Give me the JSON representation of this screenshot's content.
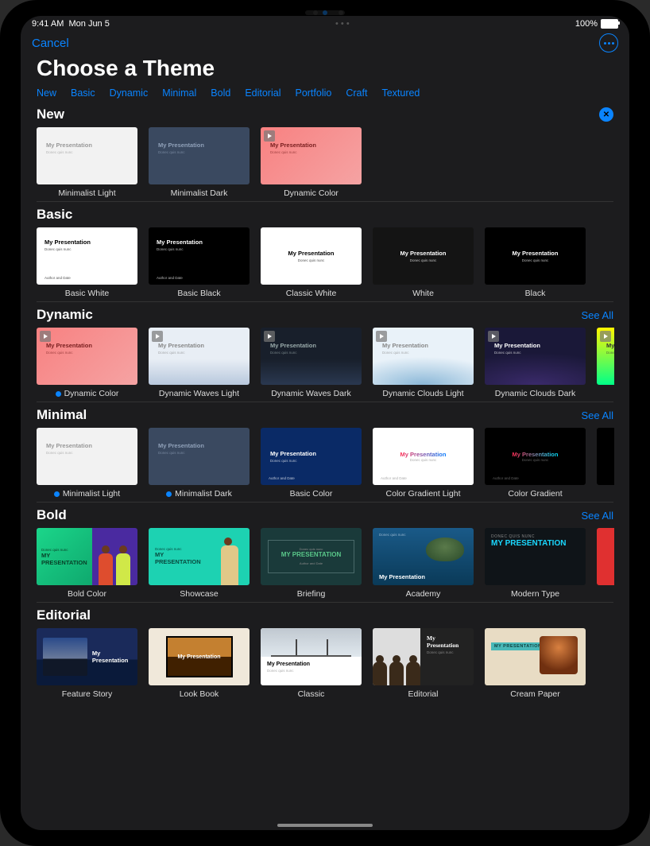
{
  "status": {
    "time": "9:41 AM",
    "date": "Mon Jun 5",
    "battery": "100%"
  },
  "nav": {
    "cancel": "Cancel"
  },
  "title": "Choose a Theme",
  "categories": [
    "New",
    "Basic",
    "Dynamic",
    "Minimal",
    "Bold",
    "Editorial",
    "Portfolio",
    "Craft",
    "Textured"
  ],
  "see_all": "See All",
  "preview": {
    "heading": "My Presentation",
    "sub": "Donec quis nunc",
    "sub2": "Author and Date",
    "upper": "MY PRESENTATION",
    "donec_upper": "DONEC QUIS NUNC"
  },
  "sections": {
    "new": {
      "title": "New",
      "items": [
        {
          "label": "Minimalist Light",
          "style": "th-min-light",
          "play": false
        },
        {
          "label": "Minimalist Dark",
          "style": "th-min-dark",
          "play": false
        },
        {
          "label": "Dynamic Color",
          "style": "th-dyn-color",
          "play": true
        }
      ]
    },
    "basic": {
      "title": "Basic",
      "items": [
        {
          "label": "Basic White",
          "style": "th-basic-white"
        },
        {
          "label": "Basic Black",
          "style": "th-basic-black"
        },
        {
          "label": "Classic White",
          "style": "th-classic-white"
        },
        {
          "label": "White",
          "style": "th-white"
        },
        {
          "label": "Black",
          "style": "th-black"
        }
      ]
    },
    "dynamic": {
      "title": "Dynamic",
      "see_all": true,
      "items": [
        {
          "label": "Dynamic Color",
          "style": "th-dyn-color",
          "play": true,
          "dot": true
        },
        {
          "label": "Dynamic Waves Light",
          "style": "th-waves-light",
          "play": true
        },
        {
          "label": "Dynamic Waves Dark",
          "style": "th-waves-dark",
          "play": true
        },
        {
          "label": "Dynamic Clouds Light",
          "style": "th-clouds-light",
          "play": true
        },
        {
          "label": "Dynamic Clouds Dark",
          "style": "th-clouds-dark",
          "play": true
        },
        {
          "label": "",
          "style": "th-green",
          "play": true,
          "partial": true
        }
      ]
    },
    "minimal": {
      "title": "Minimal",
      "see_all": true,
      "items": [
        {
          "label": "Minimalist Light",
          "style": "th-min-light",
          "dot": true
        },
        {
          "label": "Minimalist Dark",
          "style": "th-min-dark",
          "dot": true
        },
        {
          "label": "Basic Color",
          "style": "th-basic-color"
        },
        {
          "label": "Color Gradient Light",
          "style": "th-grad-light"
        },
        {
          "label": "Color Gradient",
          "style": "th-grad"
        },
        {
          "label": "",
          "style": "th-dark-grad",
          "partial": true
        }
      ]
    },
    "bold": {
      "title": "Bold",
      "see_all": true,
      "items": [
        {
          "label": "Bold Color",
          "style": "th-bold-color"
        },
        {
          "label": "Showcase",
          "style": "th-showcase"
        },
        {
          "label": "Briefing",
          "style": "th-briefing"
        },
        {
          "label": "Academy",
          "style": "th-academy"
        },
        {
          "label": "Modern Type",
          "style": "th-modern"
        },
        {
          "label": "",
          "style": "th-redwhite",
          "partial": true
        }
      ]
    },
    "editorial": {
      "title": "Editorial",
      "items": [
        {
          "label": "Feature Story",
          "style": "th-feature"
        },
        {
          "label": "Look Book",
          "style": "th-look"
        },
        {
          "label": "Classic",
          "style": "th-classic"
        },
        {
          "label": "Editorial",
          "style": "th-editorial"
        },
        {
          "label": "Cream Paper",
          "style": "th-cream"
        }
      ]
    }
  }
}
